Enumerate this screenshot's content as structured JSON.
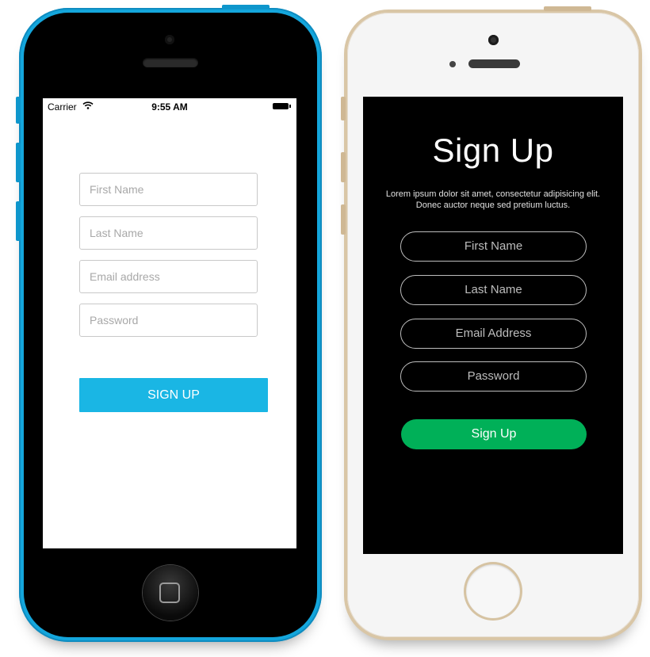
{
  "phone_left": {
    "status_bar": {
      "carrier": "Carrier",
      "time": "9:55 AM",
      "wifi_icon": "wifi-icon",
      "battery_icon": "battery-icon"
    },
    "form": {
      "first_name_placeholder": "First Name",
      "last_name_placeholder": "Last Name",
      "email_placeholder": "Email address",
      "password_placeholder": "Password",
      "signup_label": "SIGN UP"
    },
    "colors": {
      "body": "#14a6dc",
      "button": "#1ab6e4"
    }
  },
  "phone_right": {
    "title": "Sign Up",
    "description_line1": "Lorem ipsum dolor sit amet, consectetur adipisicing elit.",
    "description_line2": "Donec auctor neque sed pretium luctus.",
    "form": {
      "first_name_placeholder": "First Name",
      "last_name_placeholder": "Last Name",
      "email_placeholder": "Email Address",
      "password_placeholder": "Password",
      "signup_label": "Sign Up"
    },
    "colors": {
      "body": "#d9c6a6",
      "screen": "#000000",
      "button": "#00b058"
    }
  }
}
